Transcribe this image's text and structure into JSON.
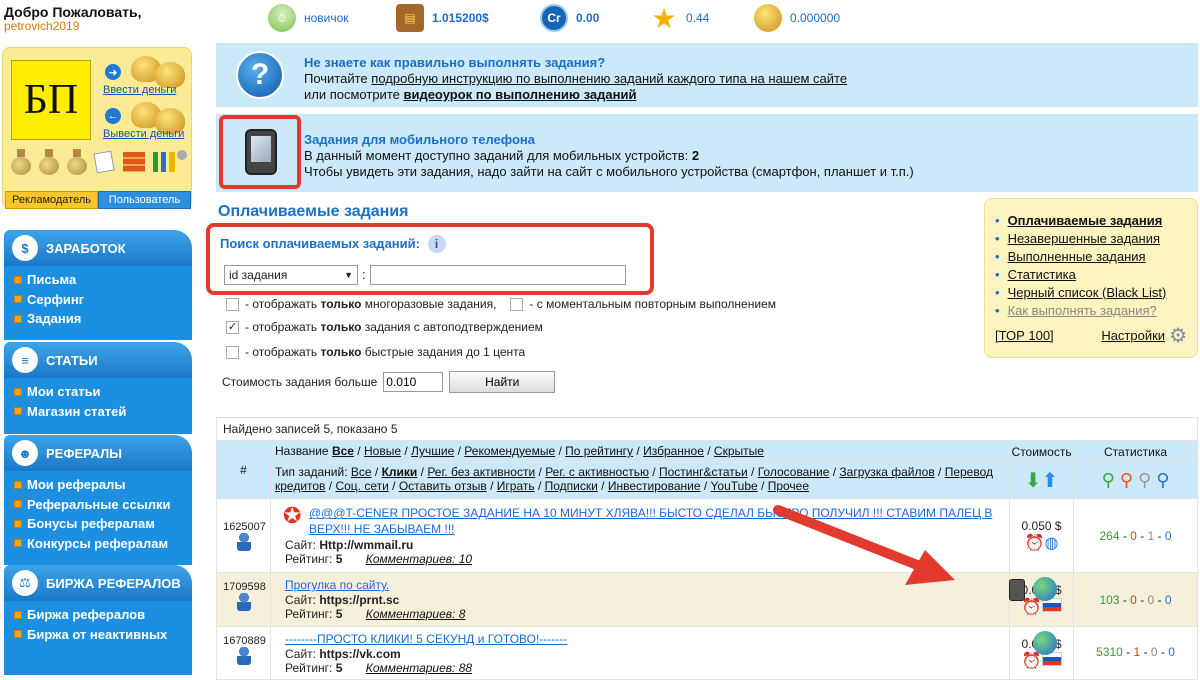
{
  "header": {
    "welcome": "Добро Пожаловать,",
    "username": "petrovich2019",
    "stats": [
      {
        "icon": "user-level-icon",
        "value": "новичок"
      },
      {
        "icon": "treasure-chest-icon",
        "value": "1.015200$"
      },
      {
        "icon": "credit-coin-icon",
        "value": "0.00"
      },
      {
        "icon": "star-icon",
        "value": "0.44"
      },
      {
        "icon": "coins-stack-icon",
        "value": "0.000000"
      }
    ]
  },
  "account": {
    "logo_text": "БП",
    "deposit": "Ввести деньги",
    "withdraw": "Вывести деньги",
    "role_advertiser": "Рекламодатель",
    "role_user": "Пользователь"
  },
  "menu": [
    {
      "title": "ЗАРАБОТОК",
      "items": [
        "Письма",
        "Серфинг",
        "Задания"
      ]
    },
    {
      "title": "СТАТЬИ",
      "items": [
        "Мои статьи",
        "Магазин статей"
      ]
    },
    {
      "title": "РЕФЕРАЛЫ",
      "items": [
        "Мои рефералы",
        "Реферальные ссылки",
        "Бонусы рефералам",
        "Конкурсы рефералам"
      ]
    },
    {
      "title": "БИРЖА РЕФЕРАЛОВ",
      "items": [
        "Биржа рефералов",
        "Биржа от неактивных"
      ]
    }
  ],
  "help": {
    "title": "Не знаете как правильно выполнять задания?",
    "line1_pre": "Почитайте ",
    "line1_link": "подробную инструкцию по выполнению заданий каждого типа на нашем сайте",
    "line2_pre": "или посмотрите ",
    "line2_link": "видеоурок по выполнению заданий"
  },
  "mobile": {
    "title": "Задания для мобильного телефона",
    "line1": "В данный момент доступно заданий для мобильных устройств:",
    "count": "2",
    "line2": "Чтобы увидеть эти задания, надо зайти на сайт с мобильного устройства (смартфон, планшет и т.п.)"
  },
  "section_title": "Оплачиваемые задания",
  "search": {
    "title": "Поиск оплачиваемых заданий:",
    "select_value": "id задания",
    "colon": ":",
    "input_value": ""
  },
  "filters": {
    "f1_pre": "- отображать ",
    "f1_bold": "только",
    "f1_post": " многоразовые задания,",
    "f1b": "- с моментальным повторным выполнением",
    "f2_pre": "- отображать ",
    "f2_bold": "только",
    "f2_post": " задания с автоподтверждением",
    "f3_pre": "- отображать ",
    "f3_bold": "только",
    "f3_post": " быстрые задания до 1 цента",
    "cost_label": "Стоимость задания больше",
    "cost_value": "0.010",
    "find_button": "Найти"
  },
  "sidebar": {
    "links": [
      "Оплачиваемые задания",
      "Незавершенные задания",
      "Выполненные задания",
      "Статистика",
      "Черный список (Black List)",
      "Как выполнять задания?"
    ],
    "top100": "[ТОР 100]",
    "settings": "Настройки"
  },
  "table": {
    "found": "Найдено записей 5, показано 5",
    "col_hash": "#",
    "col_cost": "Стоимость",
    "col_stats": "Статистика",
    "name_label": "Название",
    "sorts": [
      "Все",
      "Новые",
      "Лучшие",
      "Рекомендуемые",
      "По рейтингу",
      "Избранное",
      "Скрытые"
    ],
    "type_label": "Тип заданий:",
    "types": [
      "Все",
      "Клики",
      "Рег. без активности",
      "Рег. с активностью",
      "Постинг&статьи",
      "Голосование",
      "Загрузка файлов",
      "Перевод кредитов",
      "Соц. сети",
      "Оставить отзыв",
      "Играть",
      "Подписки",
      "Инвестирование",
      "YouTube",
      "Прочее"
    ],
    "site_label": "Сайт:",
    "rating_label": "Рейтинг:",
    "rows": [
      {
        "id": "1625007",
        "title": "@@@T-CENER ПРОСТОЕ ЗАДАНИЕ НА 10 МИНУТ ХЛЯВА!!! БЫСТО СДЕЛАЛ БЫСТРО ПОЛУЧИЛ !!! СТАВИМ ПАЛЕЦ В ВЕРХ!!! НЕ ЗАБЫВАЕМ !!!",
        "site": "Http://wmmail.ru",
        "rating": "5",
        "comments": "Комментариев: 10",
        "cost": "0.050 $",
        "s1": "264",
        "s2": "0",
        "s3": "1",
        "s4": "0"
      },
      {
        "id": "1709598",
        "title": "Прогулка по сайту.",
        "site": "https://prnt.sc",
        "rating": "5",
        "comments": "Комментариев: 8",
        "cost": "0.030 $",
        "s1": "103",
        "s2": "0",
        "s3": "0",
        "s4": "0"
      },
      {
        "id": "1670889",
        "title": "--------ПРОСТО КЛИКИ! 5 СЕКУНД и ГОТОВО!-------",
        "site": "https://vk.com",
        "rating": "5",
        "comments": "Комментариев: 88",
        "cost": "0.010 $",
        "s1": "5310",
        "s2": "1",
        "s3": "0",
        "s4": "0"
      }
    ]
  }
}
